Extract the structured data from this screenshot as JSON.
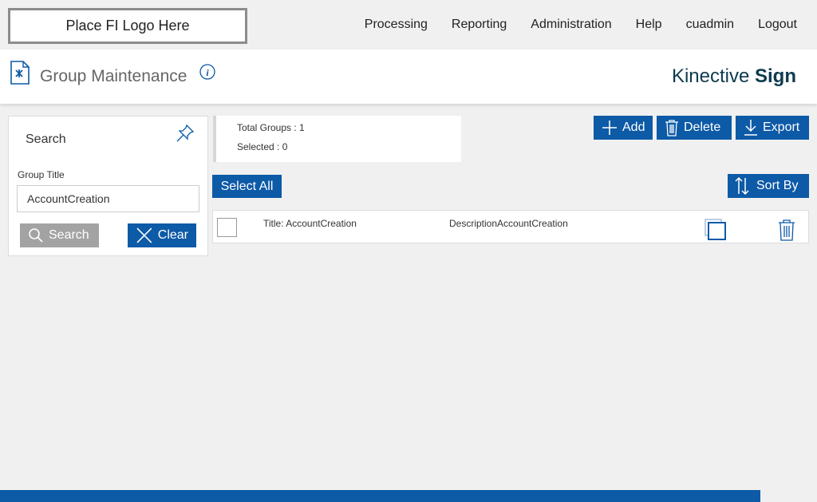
{
  "header": {
    "logo_text": "Place FI Logo Here",
    "nav": [
      "Processing",
      "Reporting",
      "Administration",
      "Help",
      "cuadmin",
      "Logout"
    ]
  },
  "page": {
    "title": "Group Maintenance",
    "brand_light": "Kinective ",
    "brand_bold": "Sign"
  },
  "search_panel": {
    "heading": "Search",
    "field_label": "Group Title",
    "field_value": "AccountCreation",
    "search_label": "Search",
    "clear_label": "Clear"
  },
  "stats": {
    "total": "Total Groups : 1",
    "selected": "Selected : 0"
  },
  "actions": {
    "add": "Add",
    "delete": "Delete",
    "export": "Export",
    "select_all": "Select All",
    "sort_by": "Sort By"
  },
  "results": [
    {
      "title": "Title: AccountCreation",
      "description": "DescriptionAccountCreation"
    }
  ],
  "colors": {
    "primary": "#0d5aa7",
    "brand_text": "#0d3a4e",
    "search_button": "#a3a3a3"
  }
}
